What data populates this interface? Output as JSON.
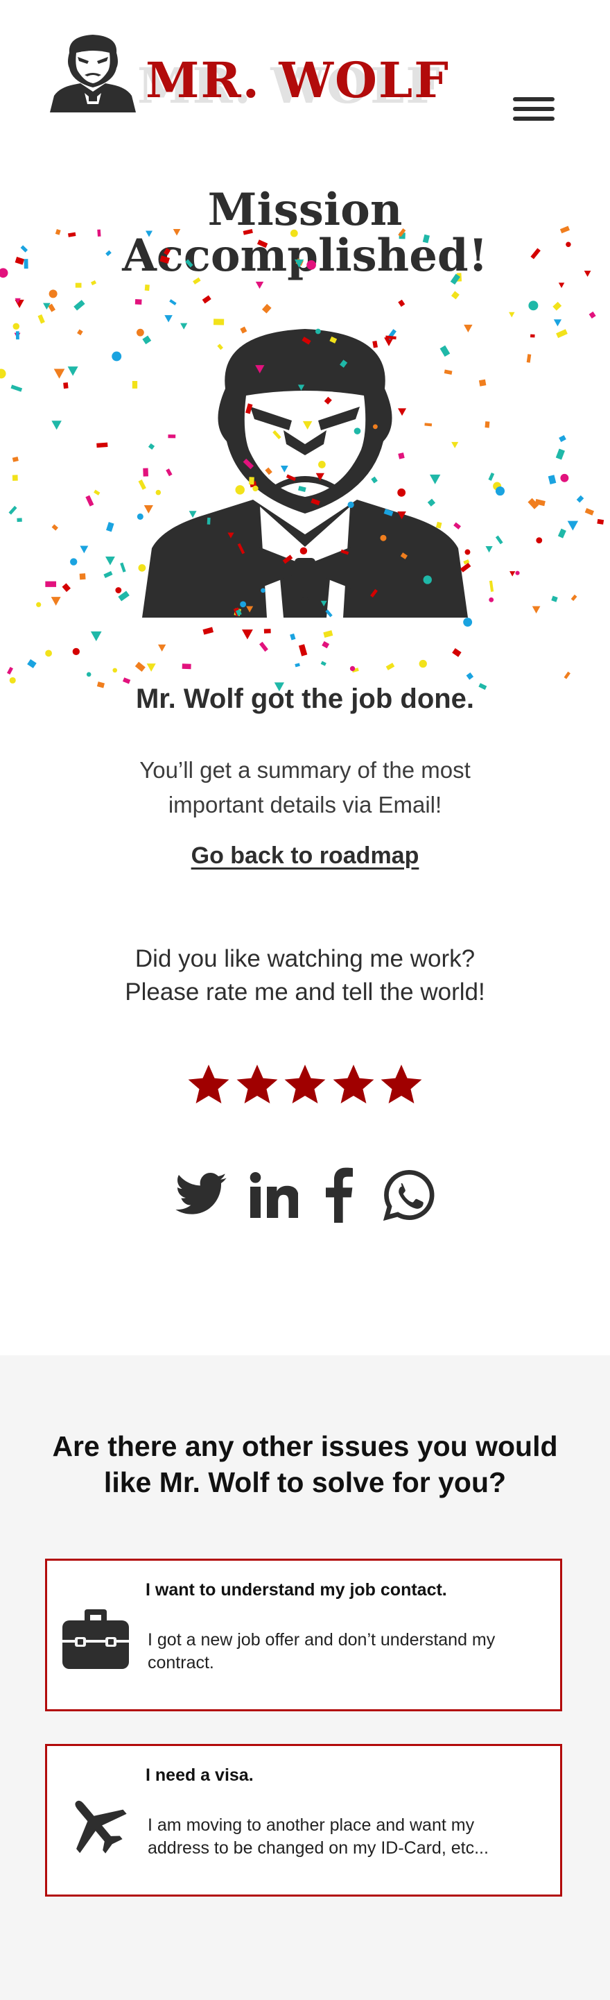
{
  "header": {
    "brand": "MR. WOLF",
    "logo_icon": "wolf-mascot-icon",
    "menu_icon": "hamburger-menu-icon"
  },
  "hero": {
    "title_line1": "Mission",
    "title_line2": "Accomplished!",
    "illustration": "wolf-in-tuxedo-with-confetti",
    "confetti_colors": [
      "#1fb8a8",
      "#f2e21a",
      "#f07e1e",
      "#e2127d",
      "#d40000",
      "#1aa3e0"
    ]
  },
  "result": {
    "headline": "Mr. Wolf got the job done.",
    "summary": "You’ll get a summary of the most important details via Email!",
    "back_link": "Go back to roadmap"
  },
  "rating": {
    "prompt_line1": "Did you like watching me work?",
    "prompt_line2": "Please rate me and tell the world!",
    "stars_total": 5,
    "star_color": "#a00000",
    "star_icon": "star-icon"
  },
  "share": {
    "networks": [
      {
        "name": "Twitter",
        "icon": "twitter-icon"
      },
      {
        "name": "LinkedIn",
        "icon": "linkedin-icon"
      },
      {
        "name": "Facebook",
        "icon": "facebook-icon"
      },
      {
        "name": "WhatsApp",
        "icon": "whatsapp-icon"
      }
    ]
  },
  "issues": {
    "title": "Are there any other issues you would like Mr. Wolf to solve for you?",
    "accent": "#b20b0b",
    "cards": [
      {
        "icon": "briefcase-icon",
        "heading": "I want to understand my job contact.",
        "description": "I got a new job offer and don’t understand my contract."
      },
      {
        "icon": "airplane-icon",
        "heading": "I need a visa.",
        "description": "I am moving to another place and want my address to be changed on my ID-Card, etc..."
      }
    ]
  }
}
